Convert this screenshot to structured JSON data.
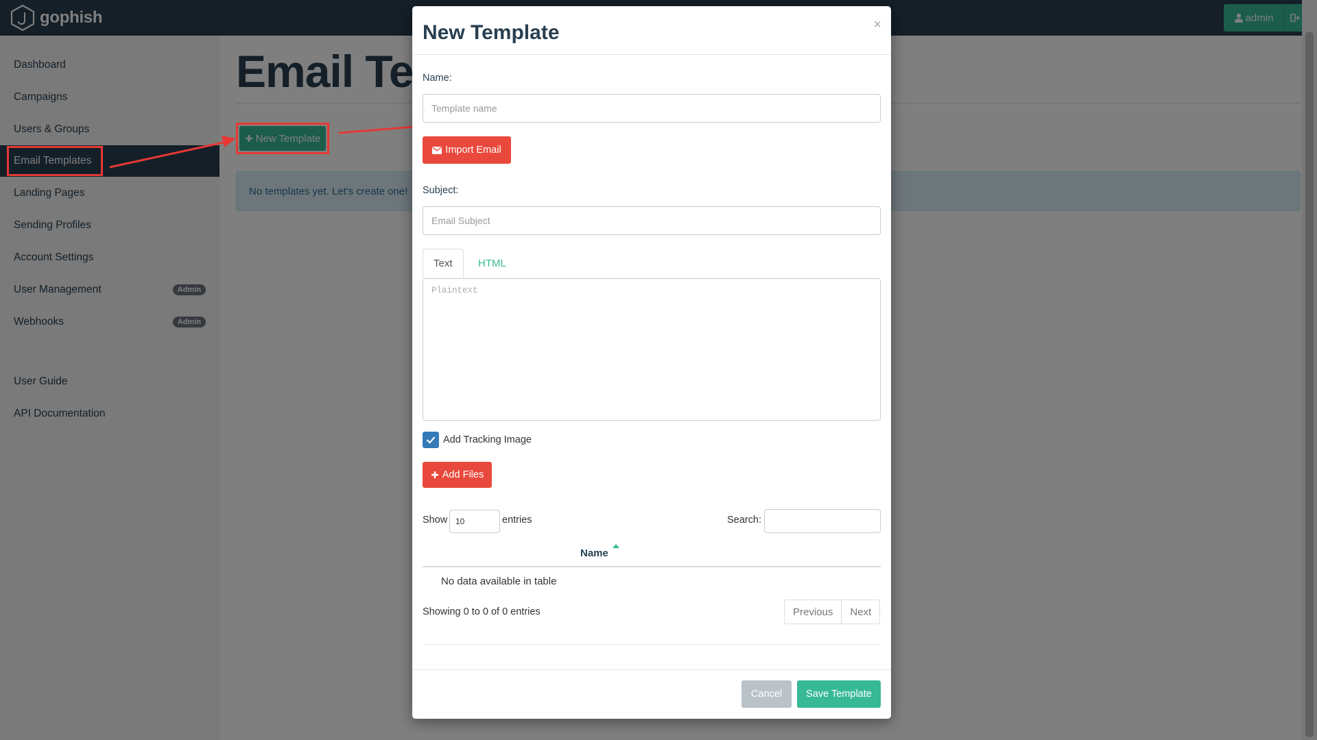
{
  "app": {
    "brand": "gophish",
    "user_label": "admin",
    "colors": {
      "navbar": "#283f50",
      "accent": "#37b996",
      "danger": "#e9493c"
    }
  },
  "sidebar": {
    "items": [
      {
        "label": "Dashboard"
      },
      {
        "label": "Campaigns"
      },
      {
        "label": "Users & Groups"
      },
      {
        "label": "Email Templates",
        "active": true
      },
      {
        "label": "Landing Pages"
      },
      {
        "label": "Sending Profiles"
      },
      {
        "label": "Account Settings"
      },
      {
        "label": "User Management",
        "badge": "Admin"
      },
      {
        "label": "Webhooks",
        "badge": "Admin"
      }
    ],
    "secondary": [
      {
        "label": "User Guide"
      },
      {
        "label": "API Documentation"
      }
    ]
  },
  "main": {
    "title": "Email Templates",
    "new_button_label": "New Template",
    "empty_message": "No templates yet. Let's create one!"
  },
  "modal": {
    "title": "New Template",
    "close_glyph": "×",
    "name_label": "Name:",
    "name_placeholder": "Template name",
    "import_label": "Import Email",
    "subject_label": "Subject:",
    "subject_placeholder": "Email Subject",
    "tabs": [
      {
        "label": "Text",
        "active": true
      },
      {
        "label": "HTML"
      }
    ],
    "text_placeholder": "Plaintext",
    "tracking_label": "Add Tracking Image",
    "tracking_checked": true,
    "add_files_label": "Add Files",
    "table": {
      "show_label": "Show",
      "entries_value": "10",
      "entries_label": "entries",
      "search_label": "Search:",
      "column_name": "Name",
      "empty_text": "No data available in table",
      "info_text": "Showing 0 to 0 of 0 entries",
      "prev_label": "Previous",
      "next_label": "Next"
    },
    "cancel_label": "Cancel",
    "save_label": "Save Template"
  }
}
